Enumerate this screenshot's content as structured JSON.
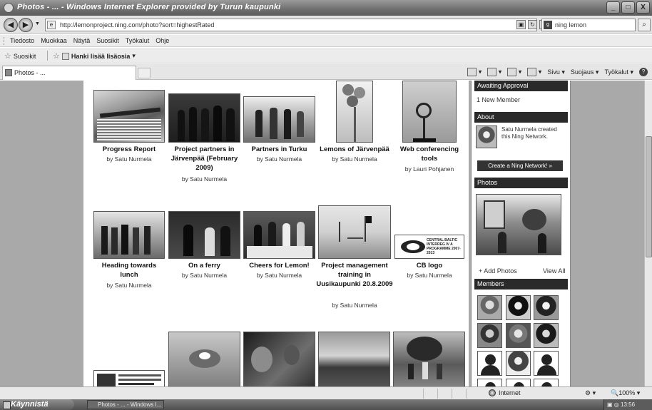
{
  "window": {
    "title": "Photos - ... - Windows Internet Explorer provided by Turun kaupunki",
    "controls": [
      "_",
      "□",
      "X"
    ]
  },
  "address": {
    "url": "http://lemonproject.ning.com/photo?sort=highestRated",
    "search_value": "ning lemon"
  },
  "menu": [
    "Tiedosto",
    "Muokkaa",
    "Näytä",
    "Suosikit",
    "Työkalut",
    "Ohje"
  ],
  "favorites": {
    "label": "Suosikit",
    "link": "Hanki lisää lisäosia"
  },
  "tab": {
    "label": "Photos - ..."
  },
  "commandbar": {
    "page": "Sivu",
    "safety": "Suojaus",
    "tools": "Työkalut"
  },
  "photos": [
    {
      "title": "Progress Report",
      "by": "by Satu Nurmela"
    },
    {
      "title": "Project partners in Järvenpää (February 2009)",
      "by": "by Satu Nurmela"
    },
    {
      "title": "Partners in Turku",
      "by": "by Satu Nurmela"
    },
    {
      "title": "Lemons of Järvenpää",
      "by": "by Satu Nurmela"
    },
    {
      "title": "Web conferencing tools",
      "by": "by Lauri Pohjanen"
    },
    {
      "title": "Heading towards lunch",
      "by": "by Satu Nurmela"
    },
    {
      "title": "On a ferry",
      "by": "by Satu Nurmela"
    },
    {
      "title": "Cheers for Lemon!",
      "by": "by Satu Nurmela"
    },
    {
      "title": "Project management training in Uusikaupunki 20.8.2009",
      "by": "by Satu Nurmela"
    },
    {
      "title": "CB logo",
      "by": "by Satu Nurmela"
    }
  ],
  "cb_logo_text": "CENTRAL BALTIC INTERREG IV A PROGRAMME 2007-2013",
  "sidebar": {
    "awaiting": {
      "heading": "Awaiting Approval",
      "item": "1 New Member"
    },
    "about": {
      "heading": "About",
      "text": "Satu Nurmela created this Ning Network.",
      "button": "Create a Ning Network! »"
    },
    "photos": {
      "heading": "Photos",
      "add": "+ Add Photos",
      "view_all": "View All"
    },
    "members": {
      "heading": "Members"
    }
  },
  "status": {
    "zone": "Internet",
    "zoom": "100%"
  },
  "taskbar": {
    "start": "Käynnistä",
    "item": "Photos - ... - Windows I...",
    "clock": "13:56"
  }
}
